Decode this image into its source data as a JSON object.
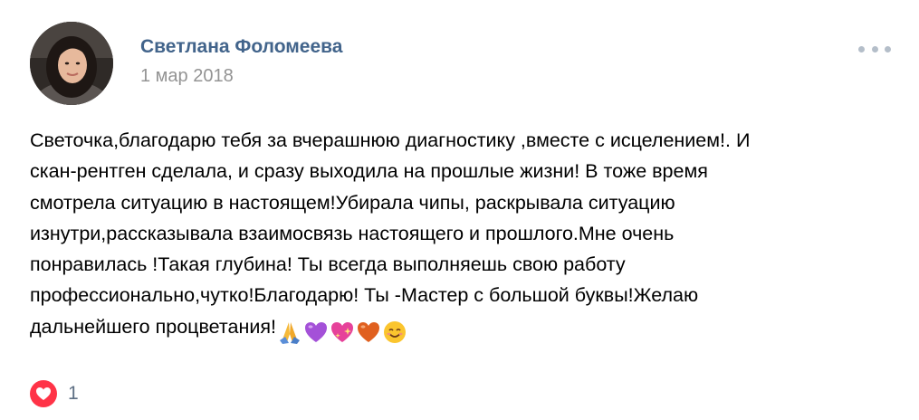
{
  "post": {
    "author": "Светлана Фоломеева",
    "date": "1 мар 2018",
    "text": "Светочка,благодарю тебя за вчерашнюю диагностику ,вместе с исцелением!. И\nскан-рентген сделала, и сразу выходила на прошлые жизни! В тоже время\nсмотрела ситуацию в настоящем!Убирала чипы, раскрывала ситуацию\nизнутри,рассказывала взаимосвязь настоящего и прошлого.Мне очень\nпонравилась !Такая глубина! Ты всегда выполняешь свою работу\nпрофессионально,чутко!Благодарю! Ты -Мастер с большой буквы!Желаю\nдальнейшего процветания!",
    "emojis": [
      "folded-hands",
      "purple-heart",
      "sparkling-heart",
      "orange-heart",
      "smiling-face"
    ],
    "likes_count": "1"
  },
  "icons": {
    "more": "more-horizontal-icon",
    "like": "heart-icon"
  },
  "colors": {
    "author": "#42648b",
    "date": "#939393",
    "like_bg": "#ff3347",
    "like_count": "#5e6f84",
    "more_dots": "#b4bec9"
  }
}
